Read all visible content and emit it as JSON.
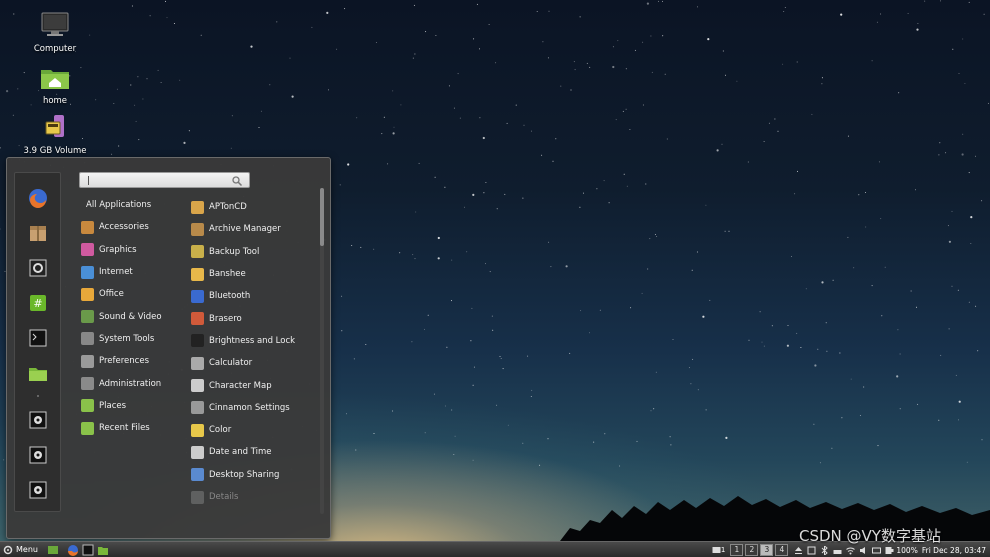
{
  "desktop": {
    "icons": [
      {
        "label": "Computer",
        "icon": "computer-icon"
      },
      {
        "label": "home",
        "icon": "home-folder-icon"
      },
      {
        "label": "3.9 GB Volume",
        "icon": "usb-drive-icon"
      }
    ]
  },
  "menu": {
    "search": {
      "value": "",
      "icon": "search-icon"
    },
    "favorites": [
      {
        "icon": "firefox-icon"
      },
      {
        "icon": "package-icon"
      },
      {
        "icon": "settings-icon"
      },
      {
        "icon": "terminal-green-icon"
      },
      {
        "icon": "terminal-icon"
      },
      {
        "icon": "folder-icon"
      },
      {
        "icon": "lock-icon"
      },
      {
        "icon": "logout-icon"
      },
      {
        "icon": "shutdown-icon"
      }
    ],
    "categories": [
      {
        "label": "All Applications",
        "icon": ""
      },
      {
        "label": "Accessories",
        "icon": "accessories-icon",
        "color": "#c8893e"
      },
      {
        "label": "Graphics",
        "icon": "graphics-icon",
        "color": "#d05aa0"
      },
      {
        "label": "Internet",
        "icon": "internet-icon",
        "color": "#4a8fd6"
      },
      {
        "label": "Office",
        "icon": "office-icon",
        "color": "#e8a83a"
      },
      {
        "label": "Sound & Video",
        "icon": "sound-video-icon",
        "color": "#6a9a4a"
      },
      {
        "label": "System Tools",
        "icon": "system-tools-icon",
        "color": "#888888"
      },
      {
        "label": "Preferences",
        "icon": "preferences-icon",
        "color": "#9a9a9a"
      },
      {
        "label": "Administration",
        "icon": "administration-icon",
        "color": "#8a8a8a"
      },
      {
        "label": "Places",
        "icon": "places-folder-icon",
        "color": "#8ac24a"
      },
      {
        "label": "Recent Files",
        "icon": "recent-files-icon",
        "color": "#8ac24a"
      }
    ],
    "apps": [
      {
        "label": "APTonCD",
        "icon": "aptoncd-icon",
        "color": "#d9a54a"
      },
      {
        "label": "Archive Manager",
        "icon": "archive-manager-icon",
        "color": "#b88a4a"
      },
      {
        "label": "Backup Tool",
        "icon": "backup-tool-icon",
        "color": "#c9b04a"
      },
      {
        "label": "Banshee",
        "icon": "banshee-icon",
        "color": "#e8b84a"
      },
      {
        "label": "Bluetooth",
        "icon": "bluetooth-icon",
        "color": "#3a6ad0"
      },
      {
        "label": "Brasero",
        "icon": "brasero-icon",
        "color": "#d05a3a"
      },
      {
        "label": "Brightness and Lock",
        "icon": "brightness-lock-icon",
        "color": "#222222"
      },
      {
        "label": "Calculator",
        "icon": "calculator-icon",
        "color": "#aaaaaa"
      },
      {
        "label": "Character Map",
        "icon": "character-map-icon",
        "color": "#cccccc"
      },
      {
        "label": "Cinnamon Settings",
        "icon": "cinnamon-settings-icon",
        "color": "#999999"
      },
      {
        "label": "Color",
        "icon": "color-icon",
        "color": "#e8c84a"
      },
      {
        "label": "Date and Time",
        "icon": "date-time-icon",
        "color": "#cccccc"
      },
      {
        "label": "Desktop Sharing",
        "icon": "desktop-sharing-icon",
        "color": "#5a8ad0"
      },
      {
        "label": "Details",
        "icon": "details-icon",
        "color": "#999999"
      }
    ]
  },
  "taskbar": {
    "menu_label": "Menu",
    "workspaces": [
      "1",
      "2",
      "3",
      "4"
    ],
    "active_workspace": "3",
    "battery": "100%",
    "clock": "Fri Dec 28, 03:47",
    "notifications": "1"
  },
  "watermark": "CSDN @VY数字基站"
}
